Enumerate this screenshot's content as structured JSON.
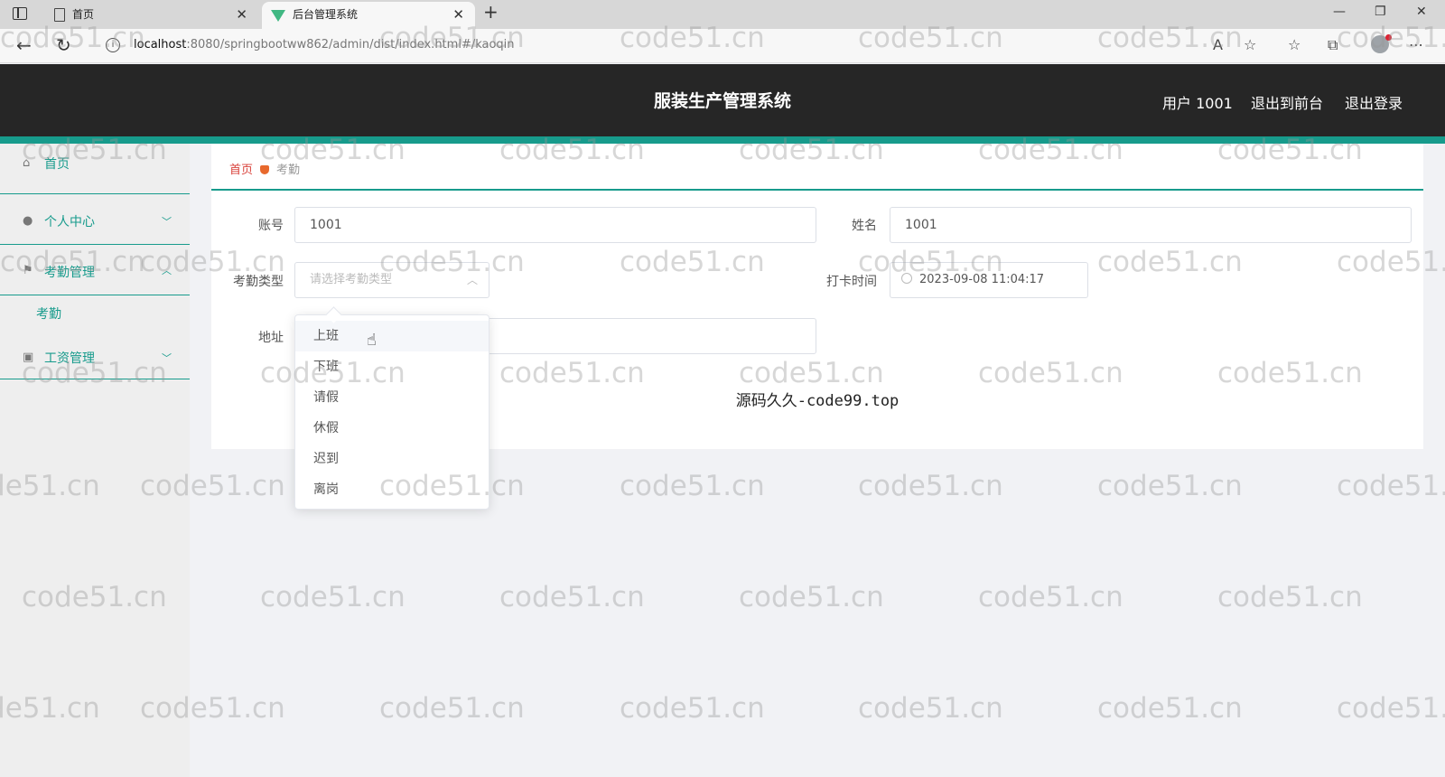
{
  "browser": {
    "tabs": [
      {
        "title": "首页",
        "icon": "page-icon"
      },
      {
        "title": "后台管理系统",
        "icon": "vue-icon"
      }
    ],
    "url_host": "localhost",
    "url_rest": ":8080/springbootww862/admin/dist/index.html#/kaoqin"
  },
  "header": {
    "title": "服装生产管理系统",
    "user": "用户 1001",
    "exit_front": "退出到前台",
    "logout": "退出登录"
  },
  "sidebar": {
    "items": [
      {
        "label": "首页",
        "icon": "home-icon"
      },
      {
        "label": "个人中心",
        "icon": "user-icon"
      },
      {
        "label": "考勤管理",
        "icon": "flag-icon"
      },
      {
        "label": "工资管理",
        "icon": "clipboard-icon"
      }
    ],
    "sub_item": "考勤"
  },
  "breadcrumb": {
    "home": "首页",
    "current": "考勤"
  },
  "form": {
    "account_label": "账号",
    "account_value": "1001",
    "name_label": "姓名",
    "name_value": "1001",
    "type_label": "考勤类型",
    "type_placeholder": "请选择考勤类型",
    "time_label": "打卡时间",
    "time_value": "2023-09-08 11:04:17",
    "address_label": "地址",
    "address_value": ""
  },
  "dropdown_options": [
    "上班",
    "下班",
    "请假",
    "休假",
    "迟到",
    "离岗"
  ],
  "caption": "源码久久-code99.top",
  "watermark": "code51.cn",
  "colors": {
    "accent": "#179b8c",
    "header_bg": "#262626",
    "breadcrumb_home": "#d9423b"
  }
}
